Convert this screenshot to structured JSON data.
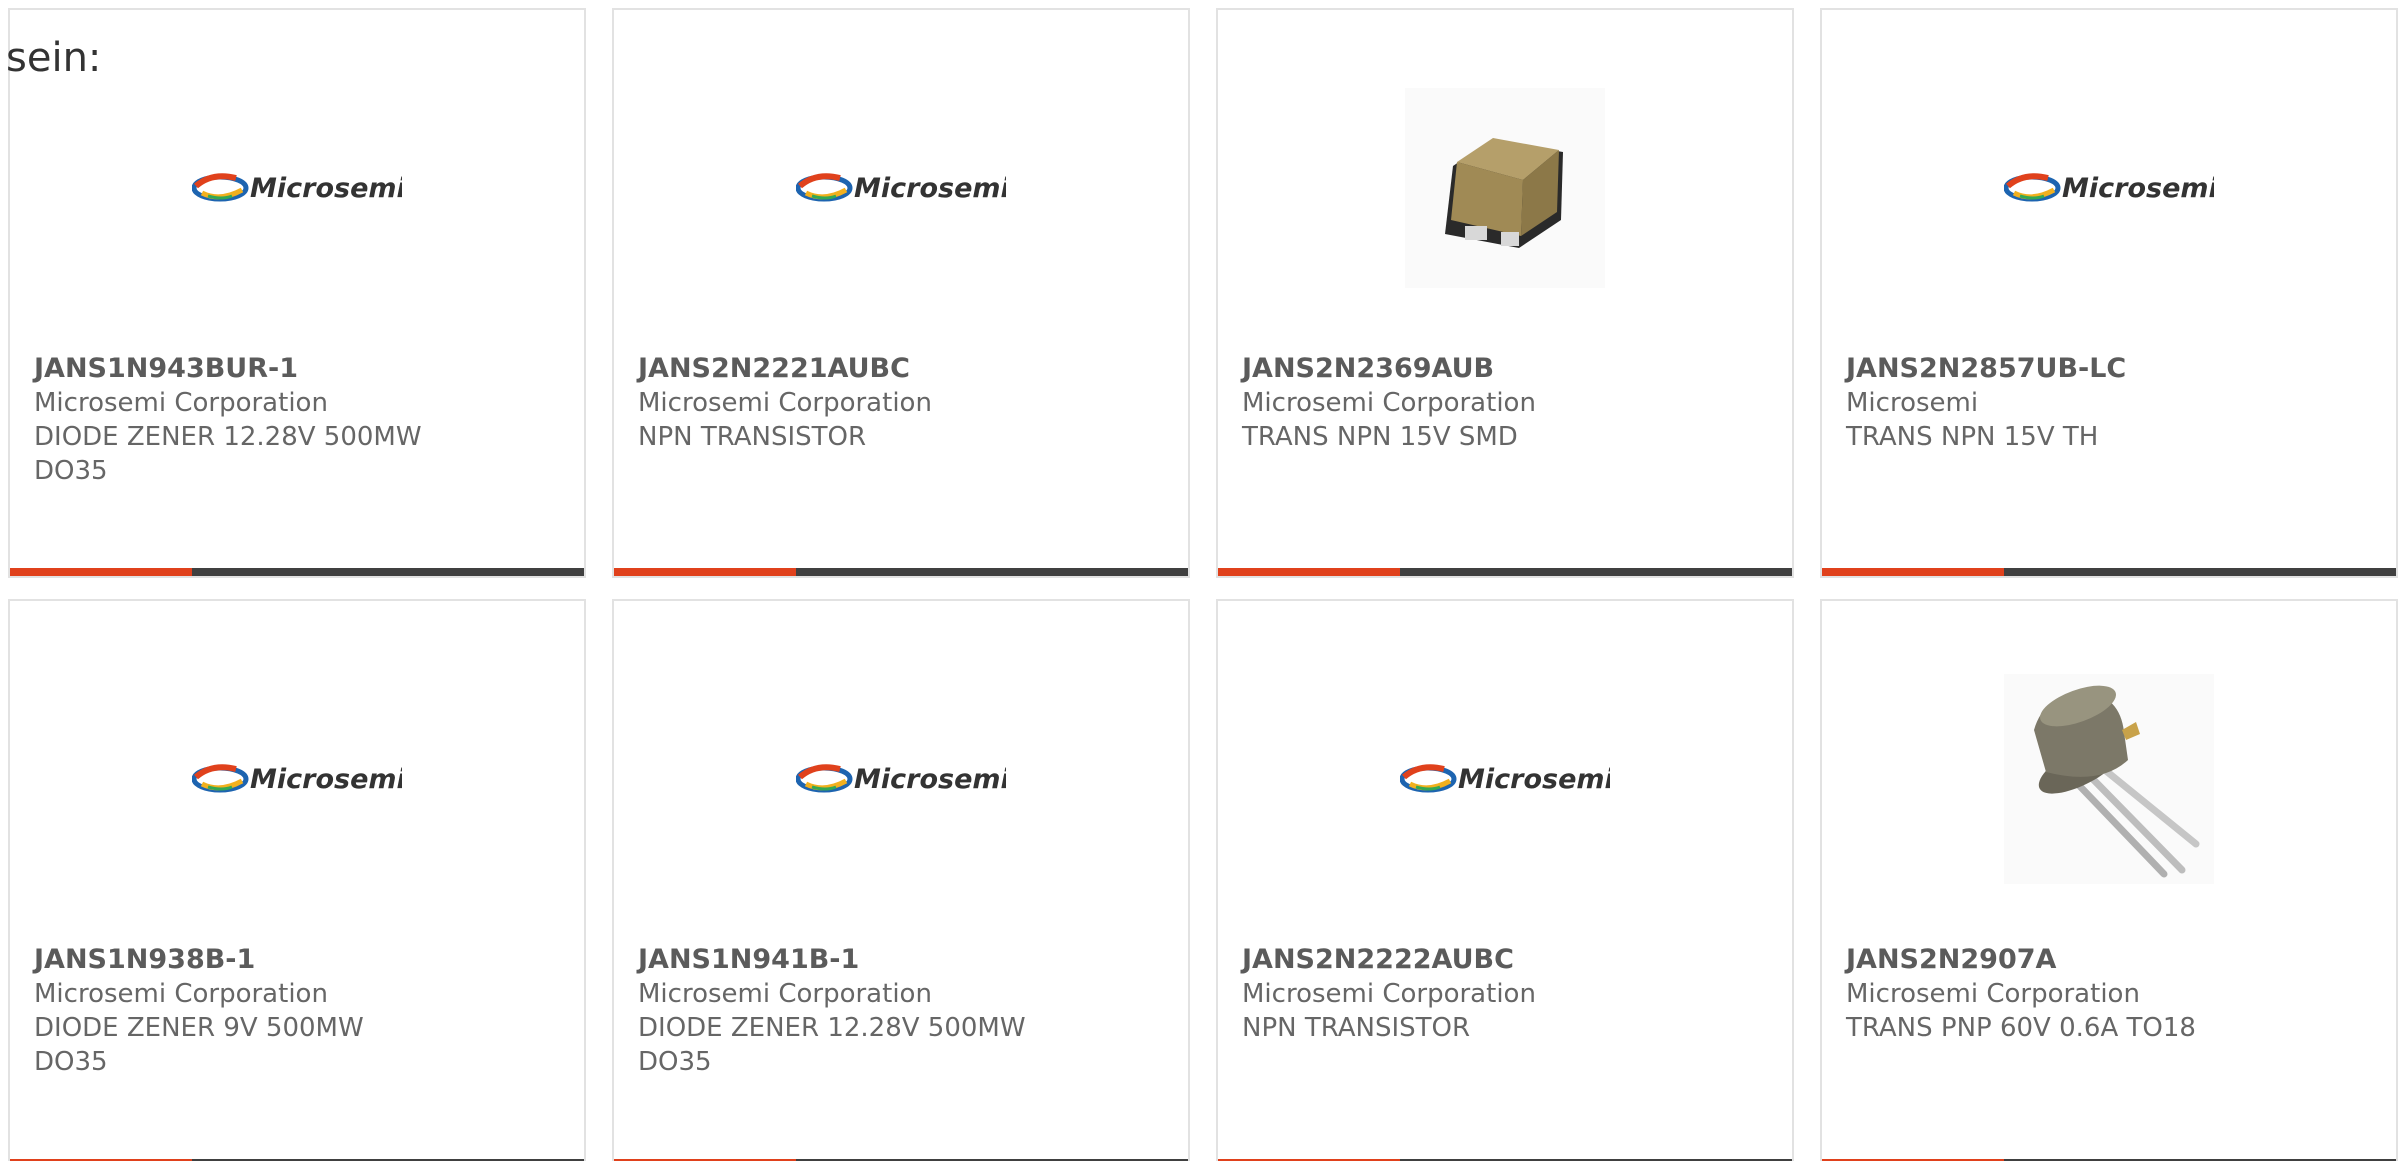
{
  "lead_text": "sein:",
  "colors": {
    "accent": "#e0411c",
    "bar": "#404040",
    "card_border": "#e2e2e2",
    "text": "#666666"
  },
  "logo_text": "Microsemi",
  "products": [
    {
      "part": "JANS1N943BUR-1",
      "manufacturer": "Microsemi Corporation",
      "description": "DIODE ZENER 12.28V 500MW DO35",
      "image": "microsemi-logo"
    },
    {
      "part": "JANS2N2221AUBC",
      "manufacturer": "Microsemi Corporation",
      "description": "NPN TRANSISTOR",
      "image": "microsemi-logo"
    },
    {
      "part": "JANS2N2369AUB",
      "manufacturer": "Microsemi Corporation",
      "description": "TRANS NPN 15V SMD",
      "image": "smd-package-photo"
    },
    {
      "part": "JANS2N2857UB-LC",
      "manufacturer": "Microsemi",
      "description": "TRANS NPN 15V TH",
      "image": "microsemi-logo"
    },
    {
      "part": "JANS1N938B-1",
      "manufacturer": "Microsemi Corporation",
      "description": "DIODE ZENER 9V 500MW DO35",
      "image": "microsemi-logo"
    },
    {
      "part": "JANS1N941B-1",
      "manufacturer": "Microsemi Corporation",
      "description": "DIODE ZENER 12.28V 500MW DO35",
      "image": "microsemi-logo"
    },
    {
      "part": "JANS2N2222AUBC",
      "manufacturer": "Microsemi Corporation",
      "description": "NPN TRANSISTOR",
      "image": "microsemi-logo"
    },
    {
      "part": "JANS2N2907A",
      "manufacturer": "Microsemi Corporation",
      "description": "TRANS PNP 60V 0.6A TO18",
      "image": "to18-transistor-photo"
    }
  ]
}
